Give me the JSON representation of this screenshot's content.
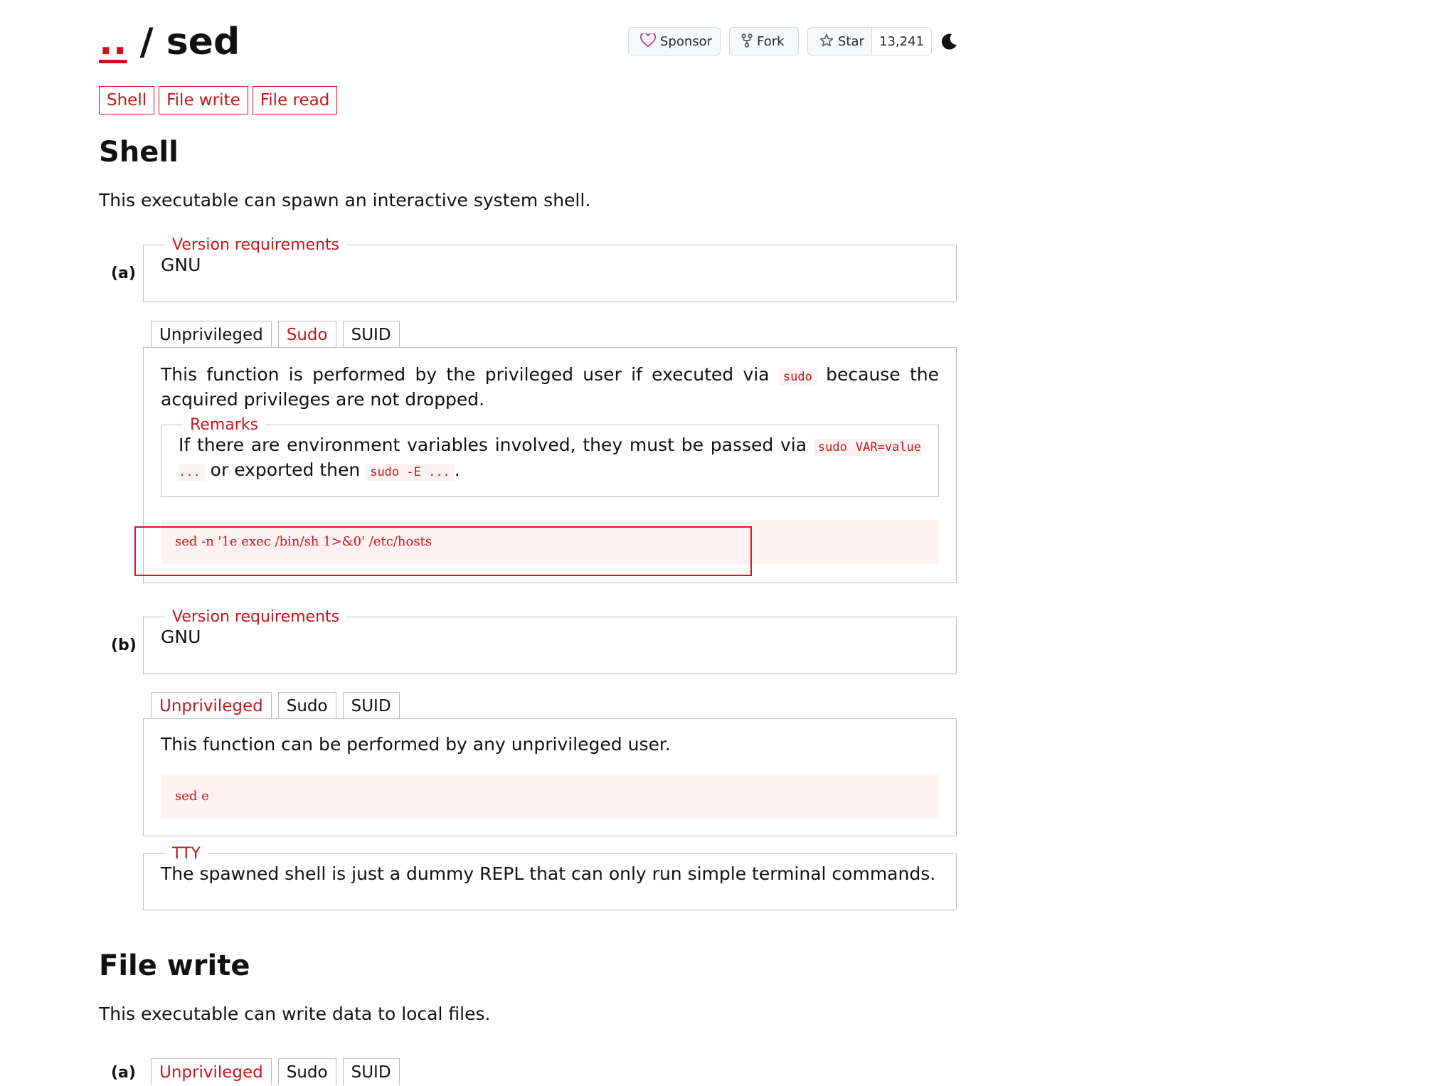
{
  "header": {
    "parent_link": "..",
    "separator": "/",
    "name": "sed",
    "sponsor_label": "Sponsor",
    "fork_label": "Fork",
    "star_label": "Star",
    "star_count": "13,241"
  },
  "tags": [
    "Shell",
    "File write",
    "File read"
  ],
  "sections": {
    "shell": {
      "title": "Shell",
      "description": "This executable can spawn an interactive system shell.",
      "a": {
        "index": "(a)",
        "version_legend": "Version requirements",
        "version_value": "GNU",
        "tabs": [
          "Unprivileged",
          "Sudo",
          "SUID"
        ],
        "active_tab": "Sudo",
        "text_before": "This function is performed by the privileged user if executed via",
        "text_code": "sudo",
        "text_after": "because the acquired privileges are not dropped.",
        "remarks_legend": "Remarks",
        "remarks_before": "If there are environment variables involved, they must be passed via",
        "remarks_code1": "sudo VAR=value ...",
        "remarks_mid": "or exported then",
        "remarks_code2": "sudo -E ...",
        "remarks_end": ".",
        "code": "sed -n '1e exec /bin/sh 1>&0' /etc/hosts"
      },
      "b": {
        "index": "(b)",
        "version_legend": "Version requirements",
        "version_value": "GNU",
        "tabs": [
          "Unprivileged",
          "Sudo",
          "SUID"
        ],
        "active_tab": "Unprivileged",
        "text": "This function can be performed by any unprivileged user.",
        "code": "sed e",
        "tty_legend": "TTY",
        "tty_text": "The spawned shell is just a dummy REPL that can only run simple terminal commands."
      }
    },
    "file_write": {
      "title": "File write",
      "description": "This executable can write data to local files.",
      "a": {
        "index": "(a)",
        "tabs": [
          "Unprivileged",
          "Sudo",
          "SUID"
        ],
        "active_tab": "Unprivileged"
      }
    }
  },
  "colors": {
    "accent": "#c4161c",
    "border": "#bdbdbd",
    "code_bg": "#fdf1f1",
    "highlight": "#e0151b"
  }
}
